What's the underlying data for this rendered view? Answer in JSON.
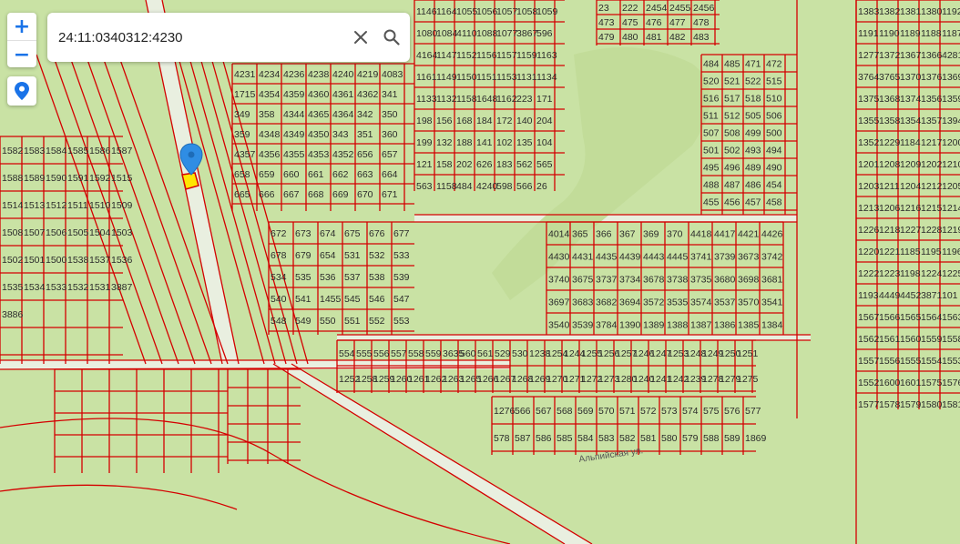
{
  "search": {
    "value": "24:11:0340312:4230",
    "placeholder": ""
  },
  "zoom": {
    "in_label": "+",
    "out_label": "−"
  },
  "colors": {
    "land": "#c9e2a4",
    "boundary": "#d40000",
    "marker": "#2f8de4",
    "highlight": "#ffe600"
  },
  "icons": {
    "clear": "close-icon",
    "search": "search-icon",
    "locate": "location-pin-icon",
    "marker": "map-marker-icon"
  },
  "map": {
    "street_labels": [
      "Альпийская ул."
    ],
    "parcels": [
      "24:11:0340312:4230",
      "4231",
      "4234",
      "4236",
      "4238",
      "4240",
      "4219",
      "4083",
      "1715",
      "4354",
      "4359",
      "4360",
      "4361",
      "4362",
      "341",
      "349",
      "358",
      "4344",
      "4365",
      "4364",
      "342",
      "350",
      "359",
      "4348",
      "4349",
      "4350",
      "343",
      "351",
      "360",
      "4357",
      "4356",
      "4355",
      "4353",
      "4352",
      "656",
      "657",
      "658",
      "659",
      "660",
      "661",
      "662",
      "663",
      "664",
      "665",
      "666",
      "667",
      "668",
      "669",
      "670",
      "671",
      "672",
      "673",
      "674",
      "675",
      "676",
      "677",
      "678",
      "679",
      "654",
      "531",
      "532",
      "533",
      "534",
      "535",
      "536",
      "537",
      "538",
      "539",
      "540",
      "541",
      "1455",
      "545",
      "546",
      "547",
      "548",
      "549",
      "550",
      "551",
      "552",
      "553",
      "554",
      "555",
      "556",
      "557",
      "558",
      "559",
      "3635",
      "560",
      "561",
      "529",
      "530",
      "1238",
      "1254",
      "1244",
      "1255",
      "1256",
      "1257",
      "1246",
      "1247",
      "1253",
      "1248",
      "1249",
      "1250",
      "1251",
      "1252",
      "1258",
      "1259",
      "1260",
      "1261",
      "1262",
      "1263",
      "1265",
      "1266",
      "1267",
      "1268",
      "1269",
      "1270",
      "1271",
      "1272",
      "1273",
      "1280",
      "1240",
      "1241",
      "1242",
      "1239",
      "1278",
      "1279",
      "1275",
      "1276",
      "566",
      "567",
      "568",
      "569",
      "570",
      "571",
      "572",
      "573",
      "574",
      "575",
      "576",
      "577",
      "578",
      "587",
      "586",
      "585",
      "584",
      "583",
      "582",
      "581",
      "580",
      "579",
      "588",
      "589",
      "1869",
      "1146",
      "1164",
      "1055",
      "1056",
      "1057",
      "1058",
      "1059",
      "1080",
      "1084",
      "4110",
      "1088",
      "1077",
      "3867",
      "596",
      "4164",
      "1147",
      "1152",
      "1156",
      "1157",
      "1159",
      "1163",
      "1161",
      "1149",
      "1150",
      "1151",
      "1153",
      "1131",
      "1134",
      "1133",
      "1132",
      "1158",
      "1648",
      "1162",
      "223",
      "171",
      "198",
      "156",
      "168",
      "184",
      "172",
      "140",
      "204",
      "199",
      "132",
      "188",
      "141",
      "102",
      "135",
      "104",
      "121",
      "158",
      "202",
      "626",
      "183",
      "562",
      "565",
      "563",
      "1158",
      "484",
      "4240",
      "598",
      "566",
      "26",
      "23",
      "222",
      "2454",
      "2455",
      "2456",
      "473",
      "475",
      "476",
      "477",
      "478",
      "479",
      "480",
      "481",
      "482",
      "483",
      "484",
      "485",
      "471",
      "472",
      "520",
      "521",
      "522",
      "515",
      "516",
      "517",
      "518",
      "510",
      "511",
      "512",
      "505",
      "506",
      "507",
      "508",
      "499",
      "500",
      "501",
      "502",
      "493",
      "494",
      "495",
      "496",
      "489",
      "490",
      "488",
      "487",
      "486",
      "454",
      "455",
      "456",
      "457",
      "458",
      "4014",
      "365",
      "366",
      "367",
      "369",
      "370",
      "4418",
      "4417",
      "4421",
      "4426",
      "4430",
      "4431",
      "4435",
      "4439",
      "4443",
      "4445",
      "3741",
      "3739",
      "3673",
      "3742",
      "3740",
      "3675",
      "3737",
      "3734",
      "3678",
      "3738",
      "3735",
      "3680",
      "3698",
      "3681",
      "3697",
      "3683",
      "3682",
      "3694",
      "3572",
      "3535",
      "3574",
      "3537",
      "3570",
      "3541",
      "3540",
      "3539",
      "3784",
      "1390",
      "1389",
      "1388",
      "1387",
      "1386",
      "1385",
      "1384",
      "1383",
      "1382",
      "1381",
      "1380",
      "1192",
      "1191",
      "1190",
      "1189",
      "1188",
      "1187",
      "1277",
      "1372",
      "1367",
      "1366",
      "4281",
      "3764",
      "3765",
      "1370",
      "1376",
      "1369",
      "1375",
      "1368",
      "1374",
      "1356",
      "1359",
      "1355",
      "1358",
      "1354",
      "1357",
      "1394",
      "1352",
      "1229",
      "1184",
      "1217",
      "1200",
      "1201",
      "1208",
      "1209",
      "1202",
      "1210",
      "1203",
      "1211",
      "1204",
      "1212",
      "1205",
      "1213",
      "1206",
      "1216",
      "1215",
      "1214",
      "1226",
      "1218",
      "1227",
      "1228",
      "1219",
      "1220",
      "1221",
      "1185",
      "1195",
      "1196",
      "1222",
      "1223",
      "1198",
      "1224",
      "1225",
      "1193",
      "4449",
      "4452",
      "3871",
      "101",
      "1567",
      "1566",
      "1565",
      "1564",
      "1563",
      "1562",
      "1561",
      "1560",
      "1559",
      "1558",
      "1557",
      "1556",
      "1555",
      "1554",
      "1553",
      "1552",
      "1600",
      "1601",
      "1575",
      "1576",
      "1577",
      "1578",
      "1579",
      "1580",
      "1581",
      "1582",
      "1583",
      "1584",
      "1585",
      "1586",
      "1587",
      "1588",
      "1589",
      "1590",
      "1591",
      "1592",
      "1515",
      "1514",
      "1513",
      "1512",
      "1511",
      "1510",
      "1509",
      "1508",
      "1507",
      "1506",
      "1505",
      "1504",
      "1503",
      "1502",
      "1501",
      "1500",
      "1538",
      "1537",
      "1536",
      "1535",
      "1534",
      "1533",
      "1532",
      "1531",
      "3887",
      "3886"
    ]
  }
}
